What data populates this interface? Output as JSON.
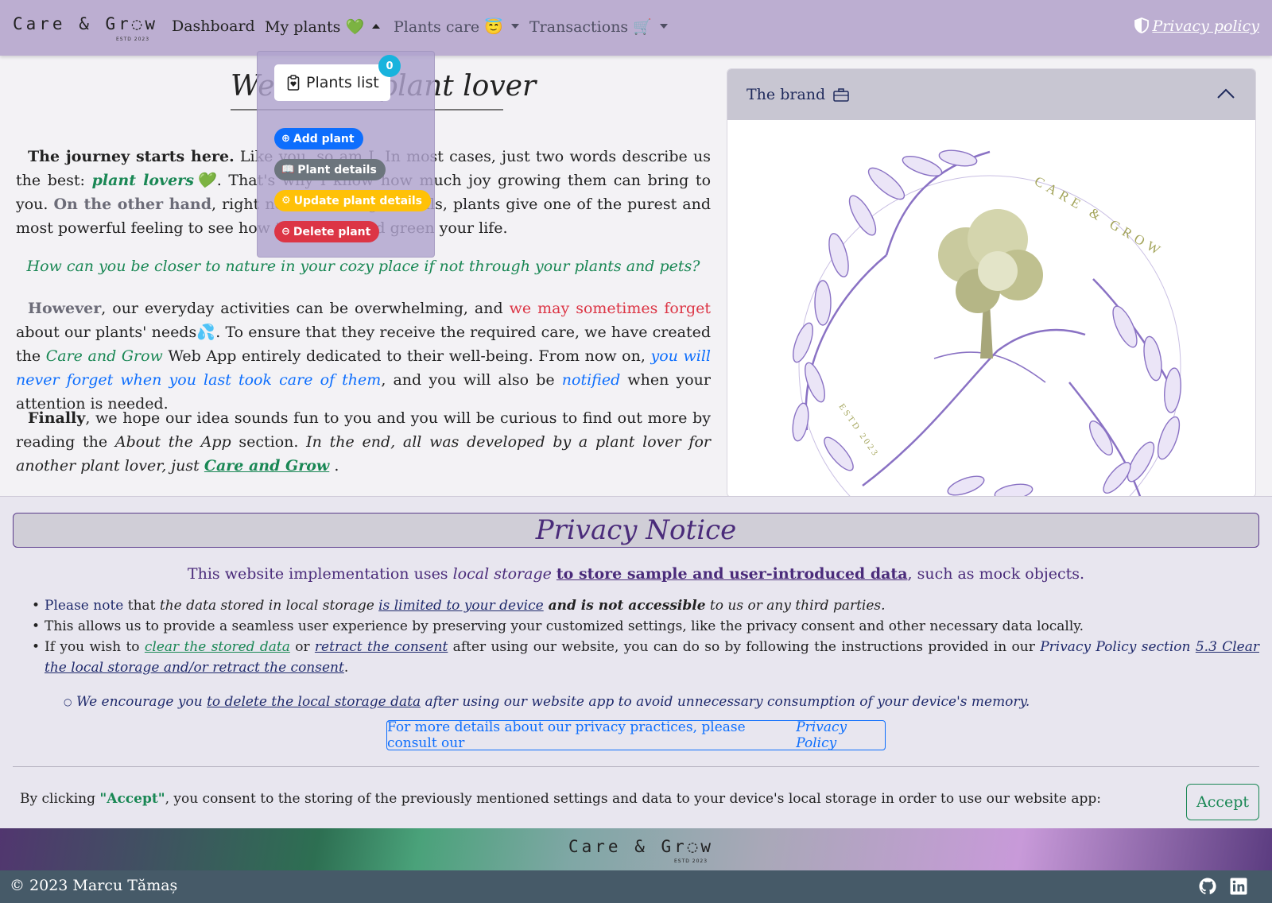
{
  "nav": {
    "brand": "Care & Gr◌w",
    "brand_estd": "ESTD 2023",
    "dashboard": "Dashboard",
    "my_plants": "My plants 💚",
    "plants_care": "Plants care 😇",
    "transactions": "Transactions 🛒",
    "privacy_policy": "Privacy policy"
  },
  "dropdown": {
    "plants_list": "Plants list",
    "badge": "0",
    "add_plant": "Add plant",
    "plant_details": "Plant details",
    "update_plant_details": "Update plant details",
    "delete_plant": "Delete plant",
    "colors": {
      "add": "#0d6efd",
      "details": "#6c757d",
      "update": "#ffc107",
      "delete": "#dc3545"
    }
  },
  "main": {
    "welcome": "Welcome, plant lover",
    "p1": {
      "lead": "The journey starts here.",
      "t1": " Like you, so am I. In most cases, just two words describe us the best: ",
      "plant_lovers": "plant lovers💚",
      "t2": ". That's why I know how much joy growing them can bring to you. ",
      "other_hand": "On the other hand",
      "t3": ", right next to raising animals, plants give one of the purest and most powerful feeling to see how they grow and green your life."
    },
    "question": "How can you be closer to nature in your cozy place if not through your plants and pets?",
    "p2": {
      "however": "However",
      "t1": ", our everyday activities can be overwhelming, and ",
      "forget": "we may sometimes forget",
      "t2": " about our plants' needs💦. To ensure that they receive the required care, we have created the ",
      "care_grow": "Care and Grow",
      "t3": " Web App entirely dedicated to their well-being. From now on, ",
      "never_forget": "you will never forget when you last took care of them",
      "t4": ", and you will also be ",
      "notified": "notified",
      "t5": " when your attention is needed."
    },
    "p3": {
      "finally": "Finally",
      "t1": ", we hope our idea sounds fun to you and you will be curious to find out more by reading the ",
      "about": "About the App",
      "t2": " section. ",
      "end": "In the end, all was developed by a plant lover for another plant lover, just ",
      "care_grow": "Care and Grow",
      "t3": " ."
    }
  },
  "card": {
    "title": "The brand",
    "logo_text": "CARE & GROW",
    "logo_estd": "ESTD 2023"
  },
  "privacy": {
    "title": "Privacy Notice",
    "intro_1": "This website implementation uses ",
    "intro_local": "local storage",
    "intro_space": " ",
    "intro_u": "to store sample and user-introduced data",
    "intro_2": ", such as mock objects.",
    "li1": {
      "please": "Please note",
      "t1": " that ",
      "data_stored": "the data stored in local storage",
      "sp": " ",
      "limited": "is limited to your device",
      "not_accessible": " and is not accessible",
      "t2": " to us or any third parties."
    },
    "li2": "This allows us to provide a seamless user experience by preserving your customized settings, like the privacy consent and other necessary data locally.",
    "li3": {
      "t1": "If you wish to ",
      "clear": "clear the stored data",
      "t2": " or ",
      "retract": "retract the consent",
      "t3": " after using our website, you can do so by following the instructions provided in our ",
      "section": "Privacy Policy section ",
      "section_link": "5.3 Clear the local storage and/or retract the consent",
      "t4": "."
    },
    "sub": {
      "t1": "We encourage you ",
      "link": "to delete the local storage data",
      "t2": " after using our website app to avoid unnecessary consumption of your device's memory."
    },
    "consult_1": "For more details about our privacy practices, please consult our ",
    "consult_2": "Privacy Policy",
    "consent_1": "By clicking ",
    "consent_accept": "\"Accept\"",
    "consent_2": ", you consent to the storing of the previously mentioned settings and data to your device's local storage in order to use our website app:",
    "accept": "Accept"
  },
  "footer": {
    "brand": "Care & Gr◌w",
    "estd": "ESTD 2023",
    "copyright": "© 2023 Marcu Tămaș",
    "icons": [
      "github-icon",
      "linkedin-icon"
    ]
  }
}
